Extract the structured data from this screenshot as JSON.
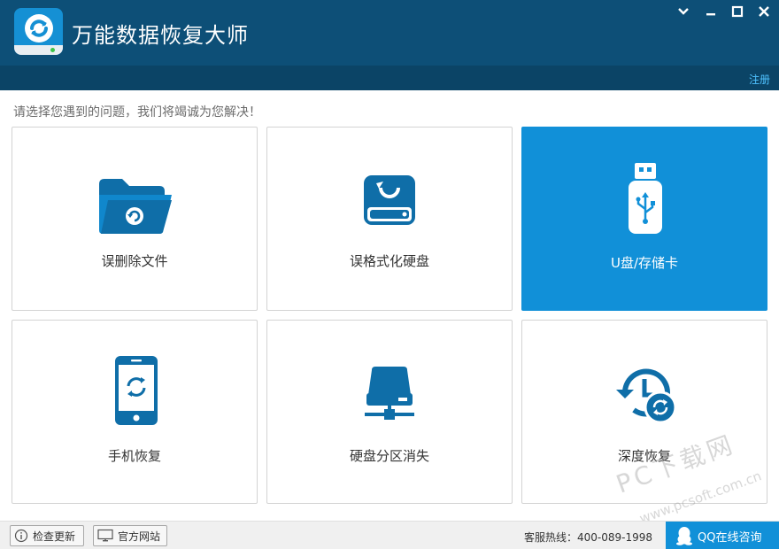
{
  "window": {
    "title": "万能数据恢复大师",
    "controls": [
      "chevron-down",
      "restore",
      "maximize",
      "close"
    ]
  },
  "header": {
    "register_label": "注册"
  },
  "main": {
    "prompt": "请选择您遇到的问题，我们将竭诚为您解决！",
    "options": [
      {
        "label": "误删除文件",
        "icon": "folder-recover-icon",
        "active": false
      },
      {
        "label": "误格式化硬盘",
        "icon": "hard-drive-recover-icon",
        "active": false
      },
      {
        "label": "U盘/存储卡",
        "icon": "usb-drive-icon",
        "active": true
      },
      {
        "label": "手机恢复",
        "icon": "phone-recover-icon",
        "active": false
      },
      {
        "label": "硬盘分区消失",
        "icon": "disk-partition-icon",
        "active": false
      },
      {
        "label": "深度恢复",
        "icon": "deep-recover-clock-icon",
        "active": false
      }
    ]
  },
  "footer": {
    "check_update": "检查更新",
    "official_site": "官方网站",
    "hotline": "客服热线：400-089-1998",
    "qq_consult": "QQ在线咨询"
  },
  "watermark": {
    "text": "PC下载网",
    "sub": "www.pcsoft.com.cn"
  },
  "colors": {
    "titlebar": "#0d4f77",
    "accent": "#1190d8",
    "icon": "#0f6ea8",
    "link": "#4fc2ff"
  }
}
